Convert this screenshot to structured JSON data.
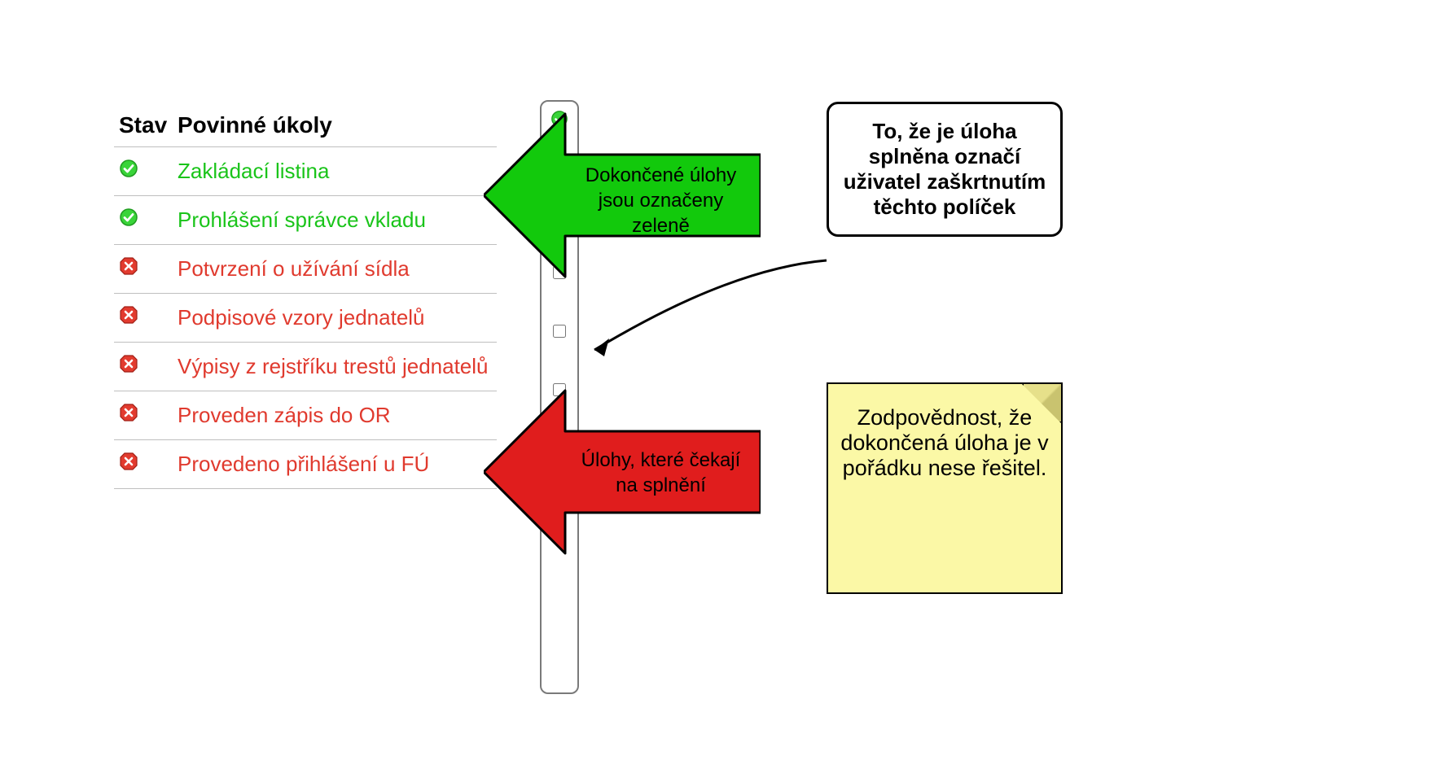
{
  "colors": {
    "done": "#1ac41a",
    "pending": "#e03a2e",
    "green_arrow": "#12c90c",
    "red_arrow": "#e01d1d",
    "sticky": "#fbf8a6"
  },
  "table": {
    "header_status": "Stav",
    "header_task": "Povinné úkoly",
    "rows": [
      {
        "label": "Zakládací listina",
        "status": "done",
        "checked": true
      },
      {
        "label": "Prohlášení správce vkladu",
        "status": "done",
        "checked": true
      },
      {
        "label": "Potvrzení o užívání sídla",
        "status": "pending",
        "checked": false
      },
      {
        "label": "Podpisové vzory jednatelů",
        "status": "pending",
        "checked": false
      },
      {
        "label": "Výpisy z rejstříku trestů jednatelů",
        "status": "pending",
        "checked": false
      },
      {
        "label": "Proveden zápis do OR",
        "status": "pending",
        "checked": false
      },
      {
        "label": "Provedeno přihlášení u FÚ",
        "status": "pending",
        "checked": false
      }
    ]
  },
  "callouts": {
    "green_arrow_text": "Dokončené úlohy jsou označeny zeleně",
    "red_arrow_text": "Úlohy, které čekají na splnění",
    "white_note_text": "To, že je úloha splněna označí uživatel zaškrtnutím těchto políček",
    "sticky_text": "Zodpovědnost, že dokončená úloha je v pořádku nese řešitel."
  }
}
